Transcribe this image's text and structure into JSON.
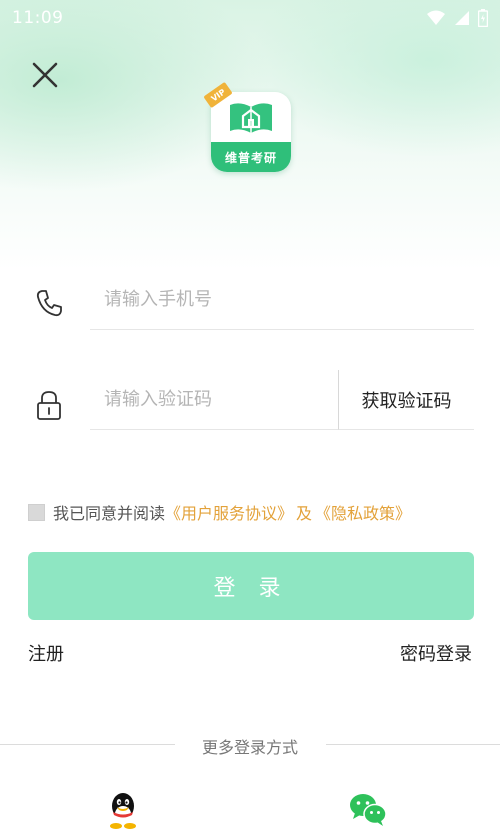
{
  "status_bar": {
    "time": "11:09"
  },
  "app": {
    "logo_text": "维普考研",
    "badge": "VIP"
  },
  "phone": {
    "placeholder": "请输入手机号"
  },
  "code": {
    "placeholder": "请输入验证码",
    "button": "获取验证码"
  },
  "agreement": {
    "prefix": "我已同意并阅读",
    "user_agreement": "《用户服务协议》",
    "and": "及",
    "privacy_policy": "《隐私政策》"
  },
  "login_button": "登 录",
  "register": "注册",
  "password_login": "密码登录",
  "more_login": "更多登录方式",
  "colors": {
    "accent": "#2fbf7a",
    "login_button": "#8ee6c2",
    "link": "#e3a23a"
  },
  "icons": [
    "close-icon",
    "phone-icon",
    "lock-icon",
    "qq-icon",
    "wechat-icon",
    "wifi-icon",
    "signal-icon",
    "battery-icon"
  ]
}
